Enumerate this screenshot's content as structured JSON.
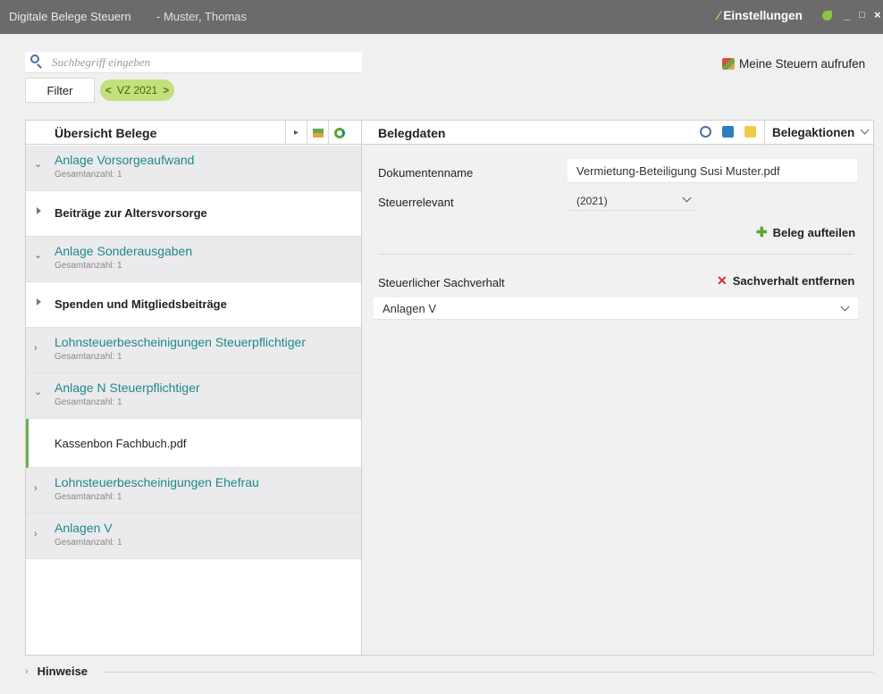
{
  "titlebar": {
    "app_name": "Digitale Belege Steuern",
    "user": "- Muster, Thomas",
    "settings_label": "Einstellungen",
    "minimize": "_",
    "maximize": "□",
    "close": "×"
  },
  "search": {
    "placeholder": "Suchbegriff eingeben"
  },
  "filter": {
    "label": "Filter"
  },
  "year_pill": {
    "label": "VZ 2021",
    "prev": "<",
    "next": ">"
  },
  "meine_steuern": {
    "label": "Meine Steuern aufrufen"
  },
  "left_panel": {
    "title": "Übersicht Belege",
    "groups": [
      {
        "type": "group",
        "label": "Anlage Vorsorgeaufwand",
        "count": "Gesamtanzahl: 1",
        "expanded": true
      },
      {
        "type": "sub",
        "label": "Beiträge zur Altersvorsorge"
      },
      {
        "type": "group",
        "label": "Anlage Sonderausgaben",
        "count": "Gesamtanzahl: 1",
        "expanded": true
      },
      {
        "type": "sub",
        "label": "Spenden und Mitgliedsbeiträge"
      },
      {
        "type": "group",
        "label": "Lohnsteuerbescheinigungen Steuerpflichtiger",
        "count": "Gesamtanzahl: 1",
        "expanded": false
      },
      {
        "type": "group",
        "label": "Anlage N Steuerpflichtiger",
        "count": "Gesamtanzahl: 1",
        "expanded": true
      },
      {
        "type": "file",
        "label": "Kassenbon Fachbuch.pdf"
      },
      {
        "type": "group",
        "label": "Lohnsteuerbescheinigungen Ehefrau",
        "count": "Gesamtanzahl: 1",
        "expanded": false
      },
      {
        "type": "group",
        "label": "Anlagen V",
        "count": "Gesamtanzahl: 1",
        "expanded": false
      }
    ]
  },
  "right_panel": {
    "title": "Belegdaten",
    "actions_label": "Belegaktionen",
    "doc_name_label": "Dokumentenname",
    "doc_name_value": "Vermietung-Beteiligung Susi Muster.pdf",
    "relevant_label": "Steuerrelevant",
    "relevant_value": "(2021)",
    "split_label": "Beleg aufteilen",
    "sachverhalt_label": "Steuerlicher Sachverhalt",
    "remove_label": "Sachverhalt entfernen",
    "sachverhalt_value": "Anlagen V"
  },
  "footer": {
    "hinweise_label": "Hinweise"
  },
  "colors": {
    "accent_teal": "#1d8a8a",
    "accent_green": "#6ab04c",
    "pill_green": "#c4e07c",
    "titlebar": "#6b6b6b"
  }
}
